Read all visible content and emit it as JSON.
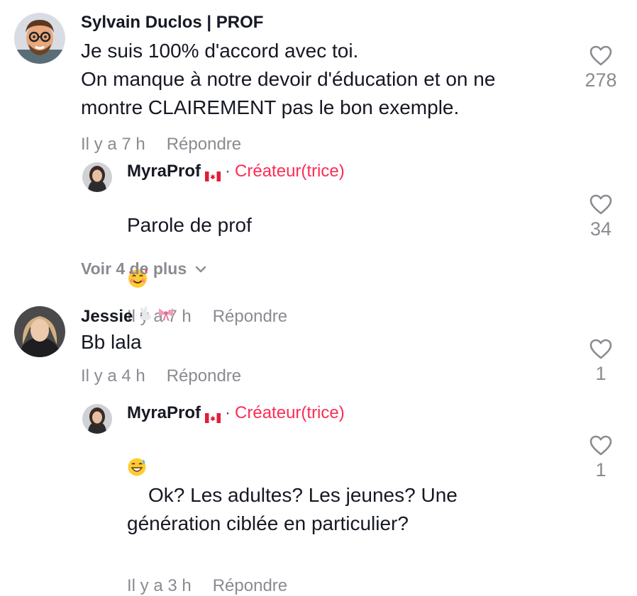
{
  "colors": {
    "text": "#161823",
    "muted": "#8a8b91",
    "creator_accent": "#fe2c55"
  },
  "comments": [
    {
      "username": "Sylvain Duclos | PROF",
      "text": "Je suis 100% d'accord avec toi.\nOn manque à notre devoir d'éducation et on ne\nmontre CLAIREMENT pas le bon exemple.",
      "time": "Il y a 7 h",
      "reply_label": "Répondre",
      "likes": "278",
      "avatar": "cartoon-man-glasses-avatar",
      "replies": [
        {
          "username": "MyraProf",
          "badge_separator": "·",
          "badge": "Créateur(trice)",
          "text": "Parole de prof",
          "emoji": "smiling-face-with-hearts-emoji",
          "time": "Il y a 7 h",
          "reply_label": "Répondre",
          "likes": "34"
        }
      ],
      "view_more": "Voir 4 de plus"
    },
    {
      "username": "Jessie",
      "username_emoji": [
        "rabbit-emoji",
        "ribbon-emoji"
      ],
      "text": "Bb lala",
      "time": "Il y a 4 h",
      "reply_label": "Répondre",
      "likes": "1",
      "replies": [
        {
          "username": "MyraProf",
          "badge_separator": "·",
          "badge": "Créateur(trice)",
          "emoji": "grinning-sweat-emoji",
          "text": "Ok? Les adultes? Les jeunes? Une\ngénération ciblée en particulier?",
          "time": "Il y a 3 h",
          "reply_label": "Répondre",
          "likes": "1"
        }
      ]
    }
  ]
}
